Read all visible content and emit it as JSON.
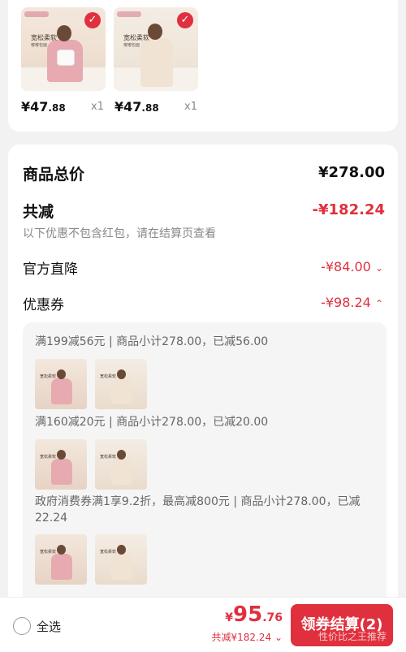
{
  "products": [
    {
      "promo_line1": "宽松柔软",
      "promo_line2": "嘟嘟包面",
      "price_main": "¥47",
      "price_cents": ".88",
      "qty": "x1"
    },
    {
      "promo_line1": "宽松柔软",
      "promo_line2": "嘟嘟包面",
      "price_main": "¥47",
      "price_cents": ".88",
      "qty": "x1"
    }
  ],
  "summary": {
    "total_label": "商品总价",
    "total_value": "¥278.00",
    "discount_label": "共减",
    "discount_value": "-¥182.24",
    "discount_note": "以下优惠不包含红包，请在结算页查看",
    "official_label": "官方直降",
    "official_value": "-¥84.00",
    "coupon_label": "优惠券",
    "coupon_value": "-¥98.24"
  },
  "coupons": [
    {
      "text": "满199减56元 | 商品小计278.00，已减56.00"
    },
    {
      "text": "满160减20元 | 商品小计278.00，已减20.00"
    },
    {
      "text": "政府消费券满1享9.2折，最高减800元 | 商品小计278.00，已减22.24"
    }
  ],
  "thumb_text": "宽松柔软",
  "bottom": {
    "select_all": "全选",
    "currency": "¥",
    "pay_int": "95",
    "pay_dec": ".76",
    "saved": "共减¥182.24",
    "checkout": "领券结算(2)"
  },
  "watermark": "性价比之王推荐",
  "colors": {
    "accent": "#e0303e"
  },
  "icons": [
    "checkmark-icon",
    "chevron-down-icon",
    "chevron-up-icon",
    "radio-icon"
  ]
}
